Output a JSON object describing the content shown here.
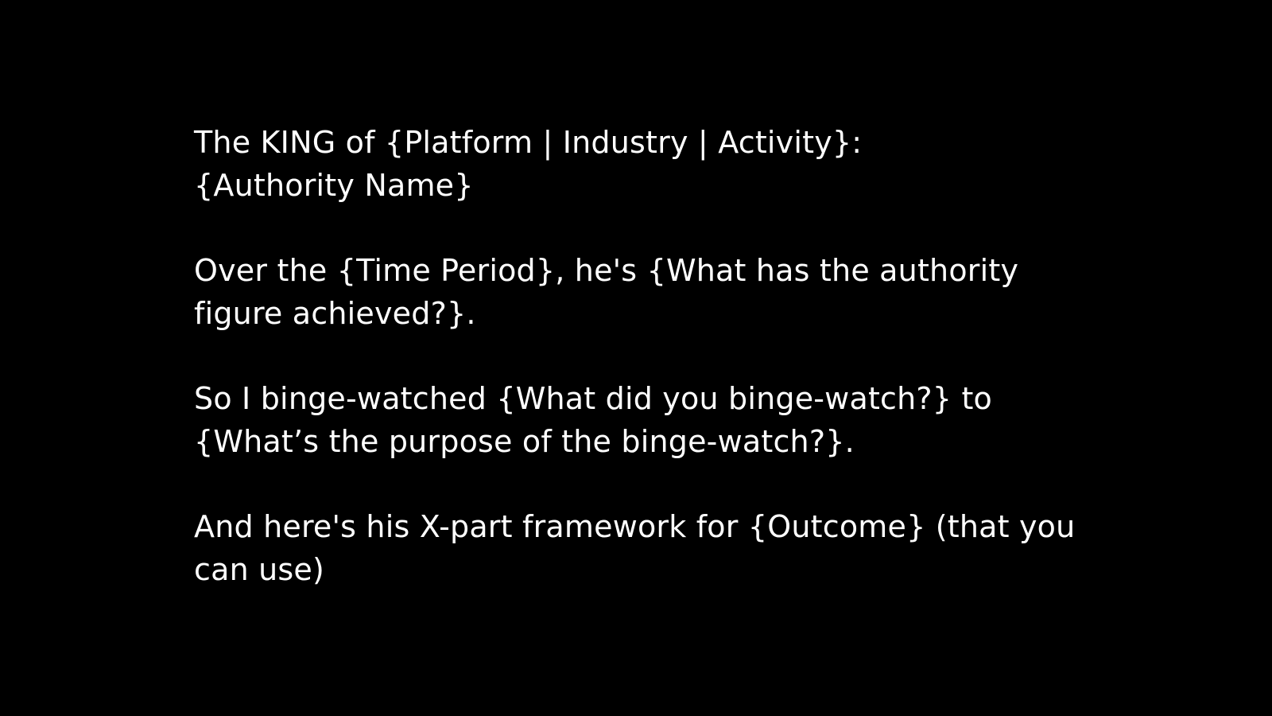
{
  "paragraphs": [
    {
      "lines": [
        "The KING of {Platform | Industry | Activity}:",
        "{Authority Name}"
      ]
    },
    {
      "lines": [
        "Over the {Time Period}, he's {What has the authority",
        "figure achieved?}."
      ]
    },
    {
      "lines": [
        "So I binge-watched {What did you binge-watch?} to",
        "{What’s the purpose of the binge-watch?}."
      ]
    },
    {
      "lines": [
        "And here's his X-part framework for {Outcome} (that you",
        "can use)"
      ]
    }
  ],
  "colors": {
    "background": "#000000",
    "text": "#ffffff"
  }
}
